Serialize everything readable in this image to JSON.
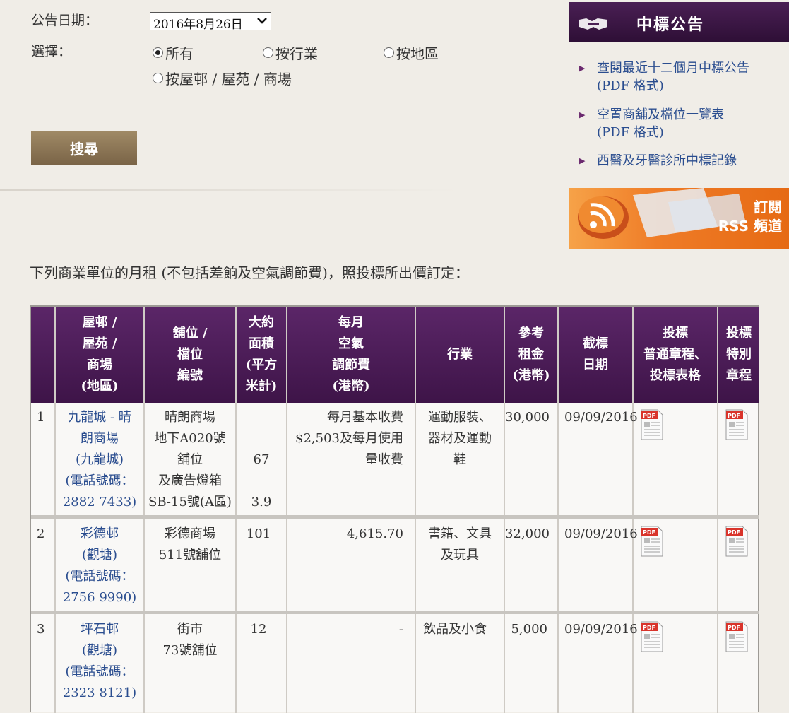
{
  "form": {
    "date_label": "公告日期：",
    "date_value": "2016年8月26日",
    "select_label": "選擇：",
    "options": [
      {
        "label": "所有",
        "checked": true
      },
      {
        "label": "按行業",
        "checked": false
      },
      {
        "label": "按地區",
        "checked": false
      },
      {
        "label": "按屋邨 / 屋苑 / 商場",
        "checked": false
      }
    ],
    "search_label": "搜尋"
  },
  "sidebar": {
    "title": "中標公告",
    "links": [
      "查閱最近十二個月中標公告\n(PDF 格式)",
      "空置商舖及檔位一覽表\n(PDF 格式)",
      "西醫及牙醫診所中標記錄"
    ],
    "rss_line1": "訂閱",
    "rss_line2": "RSS 頻道"
  },
  "intro": "下列商業單位的月租 (不包括差餉及空氣調節費)，照投標所出價訂定：",
  "table": {
    "headers": [
      "",
      "屋邨 /\n屋苑 /\n商場\n(地區)",
      "舖位 /\n檔位\n編號",
      "大約\n面積\n(平方\n米計)",
      "每月\n空氣\n調節費\n(港幣)",
      "行業",
      "參考\n租金\n(港幣)",
      "截標\n日期",
      "投標\n普通章程、\n投標表格",
      "投標\n特別\n章程"
    ],
    "rows": [
      {
        "no": "1",
        "estate": "九龍城 - 晴\n朗商場\n(九龍城)\n(電話號碼：\n2882 7433)",
        "unit": "晴朗商場\n地下A020號\n舖位\n及廣告燈箱\nSB-15號(A區)",
        "area": "\n\n67\n\n3.9",
        "ac": "每月基本收費\n$2,503及每月使用\n量收費",
        "trade": "運動服裝、\n器材及運動\n鞋",
        "rent": "30,000",
        "date": "09/09/2016"
      },
      {
        "no": "2",
        "estate": "彩德邨\n(觀塘)\n(電話號碼：\n2756 9990)",
        "unit": "彩德商場\n511號舖位",
        "area": "101",
        "ac": "4,615.70",
        "trade": "書籍、文具\n及玩具",
        "rent": "32,000",
        "date": "09/09/2016"
      },
      {
        "no": "3",
        "estate": "坪石邨\n(觀塘)\n(電話號碼：\n2323 8121)",
        "unit": "街市\n73號舖位",
        "area": "12",
        "ac": "-",
        "trade": "飲品及小食",
        "rent": "5,000",
        "date": "09/09/2016"
      }
    ],
    "pdf_label": "PDF"
  },
  "colors": {
    "header_purple": "#4a1a56",
    "link_blue": "#2a4d8f",
    "button_brown": "#8b7555",
    "rss_orange": "#ef7c27"
  }
}
